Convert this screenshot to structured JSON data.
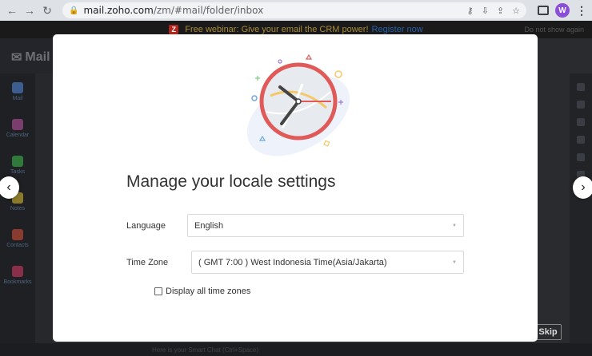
{
  "browser": {
    "url_host": "mail.zoho.com",
    "url_path": "/zm/#mail/folder/inbox",
    "profile_initial": "W"
  },
  "app": {
    "logo_text": "Mail",
    "promo_text": "Free webinar: Give your email the CRM power!",
    "promo_link": "Register now",
    "promo_dismiss": "Do not show again",
    "sidebar": [
      {
        "label": "Mail",
        "color": "#3b5d8f"
      },
      {
        "label": "Calendar",
        "color": "#7a3d6d"
      },
      {
        "label": "Tasks",
        "color": "#2f7a3b"
      },
      {
        "label": "Notes",
        "color": "#8a7a2a"
      },
      {
        "label": "Contacts",
        "color": "#8a3b2f"
      },
      {
        "label": "Bookmarks",
        "color": "#8a2f4a"
      }
    ],
    "skip_label": "Skip",
    "bottom_text": "Here is your Smart Chat (Ctrl+Space)"
  },
  "modal": {
    "title": "Manage your locale settings",
    "language_label": "Language",
    "language_value": "English",
    "timezone_label": "Time Zone",
    "timezone_value": "( GMT 7:00 ) West Indonesia Time(Asia/Jakarta)",
    "display_all_label": "Display all time zones",
    "display_all_checked": false
  },
  "colors": {
    "clock_ring": "#e05a5a",
    "modal_bg": "#ffffff",
    "overlay": "#2a2b2e"
  }
}
